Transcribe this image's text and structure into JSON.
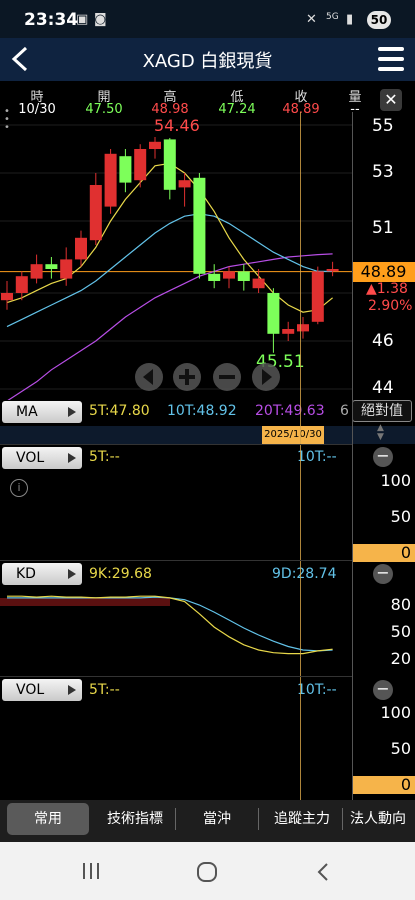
{
  "status_bar": {
    "time": "23:34",
    "battery": "50"
  },
  "header": {
    "title": "XAGD 白銀現貨"
  },
  "info": {
    "headers": [
      "時",
      "開",
      "高",
      "低",
      "收",
      "量"
    ],
    "values": [
      "10/30",
      "47.50",
      "48.98",
      "47.24",
      "48.89",
      "--"
    ]
  },
  "price_chart": {
    "y_labels": [
      "55",
      "53",
      "51",
      "48.89",
      "46",
      "44"
    ],
    "high_label": "54.46",
    "low_label": "45.51",
    "change": "▲1.38",
    "change_pct": "2.90%",
    "partial_label": "0"
  },
  "chart_data": {
    "type": "candlestick",
    "ylim": [
      43.6,
      55.6
    ],
    "candles": [
      {
        "o": 47.7,
        "c": 48.0,
        "h": 48.5,
        "l": 47.3
      },
      {
        "o": 48.0,
        "c": 48.7,
        "h": 48.9,
        "l": 47.7
      },
      {
        "o": 48.6,
        "c": 49.2,
        "h": 49.6,
        "l": 48.4
      },
      {
        "o": 49.2,
        "c": 49.0,
        "h": 49.5,
        "l": 48.6
      },
      {
        "o": 48.6,
        "c": 49.4,
        "h": 49.9,
        "l": 48.3
      },
      {
        "o": 49.4,
        "c": 50.3,
        "h": 50.6,
        "l": 49.1
      },
      {
        "o": 50.2,
        "c": 52.5,
        "h": 53.0,
        "l": 50.0
      },
      {
        "o": 51.6,
        "c": 53.8,
        "h": 54.0,
        "l": 51.3
      },
      {
        "o": 53.7,
        "c": 52.6,
        "h": 54.0,
        "l": 52.2
      },
      {
        "o": 52.7,
        "c": 54.0,
        "h": 54.2,
        "l": 52.4
      },
      {
        "o": 54.0,
        "c": 54.3,
        "h": 54.5,
        "l": 53.6
      },
      {
        "o": 54.4,
        "c": 52.3,
        "h": 54.46,
        "l": 51.9
      },
      {
        "o": 52.4,
        "c": 52.7,
        "h": 53.0,
        "l": 51.6
      },
      {
        "o": 52.8,
        "c": 48.8,
        "h": 53.0,
        "l": 48.6
      },
      {
        "o": 48.8,
        "c": 48.5,
        "h": 49.2,
        "l": 48.2
      },
      {
        "o": 48.6,
        "c": 48.9,
        "h": 49.1,
        "l": 48.2
      },
      {
        "o": 48.9,
        "c": 48.5,
        "h": 49.2,
        "l": 48.1
      },
      {
        "o": 48.2,
        "c": 48.6,
        "h": 49.0,
        "l": 48.0
      },
      {
        "o": 48.0,
        "c": 46.3,
        "h": 48.2,
        "l": 45.51
      },
      {
        "o": 46.3,
        "c": 46.5,
        "h": 46.8,
        "l": 46.0
      },
      {
        "o": 46.4,
        "c": 46.7,
        "h": 47.0,
        "l": 46.1
      },
      {
        "o": 46.8,
        "c": 48.9,
        "h": 49.1,
        "l": 46.7
      },
      {
        "o": 48.9,
        "c": 49.0,
        "h": 49.3,
        "l": 48.7
      }
    ],
    "ma5": [
      47.6,
      47.8,
      48.1,
      48.4,
      48.6,
      49.1,
      49.9,
      51.0,
      51.9,
      52.6,
      53.3,
      53.4,
      53.0,
      52.3,
      51.4,
      50.3,
      49.4,
      48.7,
      48.0,
      47.5,
      47.2,
      47.3,
      47.8
    ],
    "ma10": [
      46.6,
      46.9,
      47.2,
      47.5,
      47.8,
      48.1,
      48.5,
      49.0,
      49.5,
      50.0,
      50.5,
      50.9,
      51.2,
      51.3,
      51.2,
      50.9,
      50.5,
      50.1,
      49.7,
      49.4,
      49.1,
      48.9,
      48.9
    ],
    "ma20": [
      43.5,
      43.9,
      44.3,
      44.8,
      45.2,
      45.6,
      46.0,
      46.5,
      47.0,
      47.4,
      47.8,
      48.1,
      48.4,
      48.7,
      48.9,
      49.1,
      49.2,
      49.3,
      49.4,
      49.5,
      49.55,
      49.6,
      49.63
    ]
  },
  "ma_row": {
    "label": "MA",
    "ma5": "5T:47.80",
    "ma10": "10T:48.92",
    "ma20": "20T:49.63",
    "ma_more": "6",
    "button": "絕對值",
    "date": "2025/10/30"
  },
  "vol1": {
    "label": "VOL",
    "t5": "5T:--",
    "t10": "10T:--",
    "y_labels": [
      "100",
      "50",
      "0"
    ]
  },
  "kd": {
    "label": "KD",
    "k": "9K:29.68",
    "d": "9D:28.74",
    "y_labels": [
      "80",
      "50",
      "20"
    ],
    "k_values": [
      90,
      90,
      89,
      90,
      89,
      89,
      88,
      89,
      89,
      90,
      90,
      88,
      84,
      70,
      55,
      44,
      35,
      29,
      26,
      25,
      25,
      28,
      30
    ],
    "d_values": [
      88,
      88,
      88,
      88,
      88,
      88,
      88,
      88,
      88,
      88,
      89,
      88,
      86,
      80,
      72,
      63,
      54,
      46,
      39,
      33,
      29,
      28,
      29
    ]
  },
  "vol2": {
    "label": "VOL",
    "t5": "5T:--",
    "t10": "10T:--",
    "y_labels": [
      "100",
      "50",
      "0"
    ]
  },
  "tabs": [
    "常用",
    "技術指標",
    "當沖",
    "追蹤主力",
    "法人動向"
  ],
  "colors": {
    "up": "#e03030",
    "down": "#7dff5a",
    "ma5": "#e8d84a",
    "ma10": "#62c2e8",
    "ma20": "#b84ee6",
    "price": "#ff9e1b"
  }
}
